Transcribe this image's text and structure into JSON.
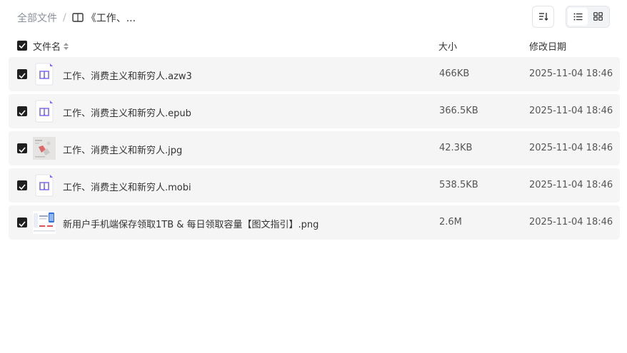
{
  "breadcrumb": {
    "root": "全部文件",
    "separator": "/",
    "current": "《工作、..."
  },
  "toolbar": {
    "sort_icon": "sort-lines-icon",
    "list_view_icon": "list-view-icon",
    "grid_view_icon": "grid-view-icon",
    "active_view": "list"
  },
  "table": {
    "columns": {
      "name": "文件名",
      "size": "大小",
      "date": "修改日期"
    },
    "select_all_checked": true,
    "rows": [
      {
        "name": "工作、消费主义和新穷人.azw3",
        "size": "466KB",
        "date": "2025-11-04 18:46",
        "type": "ebook",
        "checked": true
      },
      {
        "name": "工作、消费主义和新穷人.epub",
        "size": "366.5KB",
        "date": "2025-11-04 18:46",
        "type": "ebook",
        "checked": true
      },
      {
        "name": "工作、消费主义和新穷人.jpg",
        "size": "42.3KB",
        "date": "2025-11-04 18:46",
        "type": "image",
        "checked": true
      },
      {
        "name": "工作、消费主义和新穷人.mobi",
        "size": "538.5KB",
        "date": "2025-11-04 18:46",
        "type": "ebook",
        "checked": true
      },
      {
        "name": "新用户手机端保存领取1TB & 每日领取容量【图文指引】.png",
        "size": "2.6M",
        "date": "2025-11-04 18:46",
        "type": "screenshot",
        "checked": true
      }
    ]
  },
  "colors": {
    "row_bg": "#f5f5f6",
    "checkbox": "#1f1f1f",
    "ebook_icon": "#7b6cf0"
  }
}
